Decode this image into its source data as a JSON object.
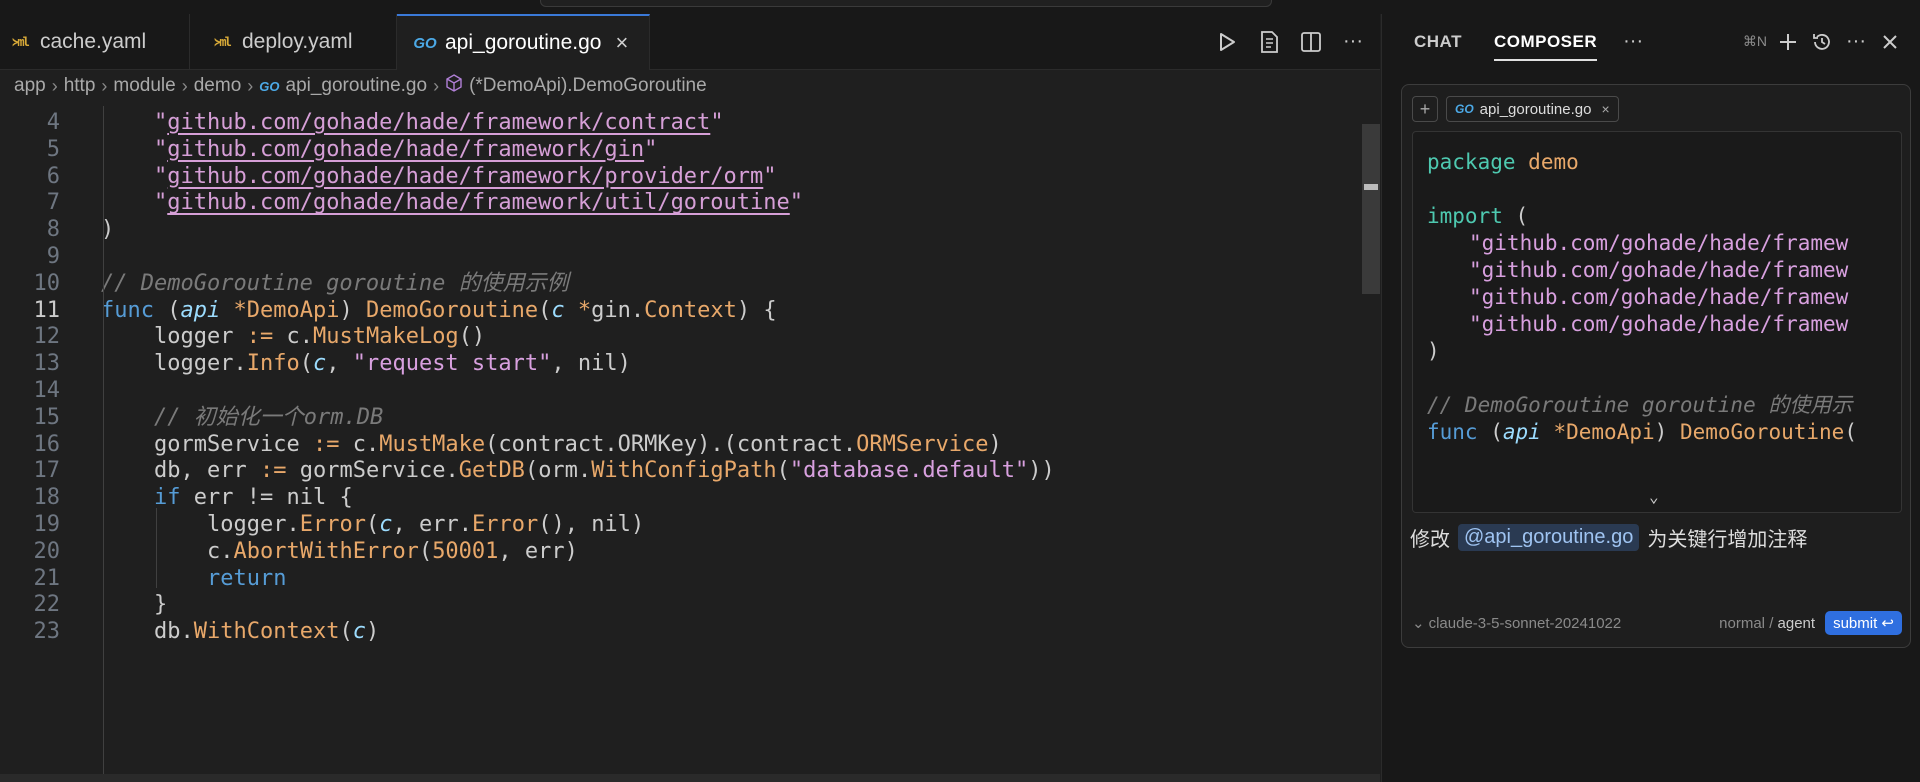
{
  "tabs": [
    {
      "label": "cache.yaml",
      "icon": "yaml-icon"
    },
    {
      "label": "deploy.yaml",
      "icon": "yaml-icon"
    },
    {
      "label": "api_goroutine.go",
      "icon": "go-icon",
      "active": true,
      "close": "×"
    }
  ],
  "breadcrumb": {
    "items": [
      "app",
      "http",
      "module",
      "demo",
      "api_goroutine.go",
      "(*DemoApi).DemoGoroutine"
    ],
    "separator": "›"
  },
  "code": {
    "current_line": 11,
    "lines": [
      {
        "n": "4",
        "text": "\"github.com/gohade/hade/framework/contract\""
      },
      {
        "n": "5",
        "text": "\"github.com/gohade/hade/framework/gin\""
      },
      {
        "n": "6",
        "text": "\"github.com/gohade/hade/framework/provider/orm\""
      },
      {
        "n": "7",
        "text": "\"github.com/gohade/hade/framework/util/goroutine\""
      },
      {
        "n": "8",
        "text": ")"
      },
      {
        "n": "9",
        "text": ""
      },
      {
        "n": "10",
        "text": "// DemoGoroutine goroutine 的使用示例"
      },
      {
        "n": "11",
        "text": "func (api *DemoApi) DemoGoroutine(c *gin.Context) {"
      },
      {
        "n": "12",
        "text": "logger := c.MustMakeLog()"
      },
      {
        "n": "13",
        "text": "logger.Info(c, \"request start\", nil)"
      },
      {
        "n": "14",
        "text": ""
      },
      {
        "n": "15",
        "text": "// 初始化一个orm.DB"
      },
      {
        "n": "16",
        "text": "gormService := c.MustMake(contract.ORMKey).(contract.ORMService)"
      },
      {
        "n": "17",
        "text": "db, err := gormService.GetDB(orm.WithConfigPath(\"database.default\"))"
      },
      {
        "n": "18",
        "text": "if err != nil {"
      },
      {
        "n": "19",
        "text": "logger.Error(c, err.Error(), nil)"
      },
      {
        "n": "20",
        "text": "c.AbortWithError(50001, err)"
      },
      {
        "n": "21",
        "text": "return"
      },
      {
        "n": "22",
        "text": "}"
      },
      {
        "n": "23",
        "text": "db.WithContext(c)"
      }
    ]
  },
  "panel": {
    "tabs": [
      "CHAT",
      "COMPOSER"
    ],
    "active_tab": "COMPOSER",
    "more": "···",
    "shortcut": "⌘N",
    "context_chip": "api_goroutine.go",
    "preview_lines": [
      "package demo",
      "",
      "import (",
      "\"github.com/gohade/hade/framew",
      "\"github.com/gohade/hade/framew",
      "\"github.com/gohade/hade/framew",
      "\"github.com/gohade/hade/framew",
      ")",
      "",
      "// DemoGoroutine goroutine 的使用示",
      "func (api *DemoApi) DemoGoroutine("
    ],
    "prompt_prefix": "修改",
    "prompt_mention": "@api_goroutine.go",
    "prompt_suffix": "为关键行增加注释",
    "model": "claude-3-5-sonnet-20241022",
    "mode_normal": "normal",
    "mode_sep": "/",
    "mode_agent": "agent",
    "submit": "submit ↩"
  }
}
